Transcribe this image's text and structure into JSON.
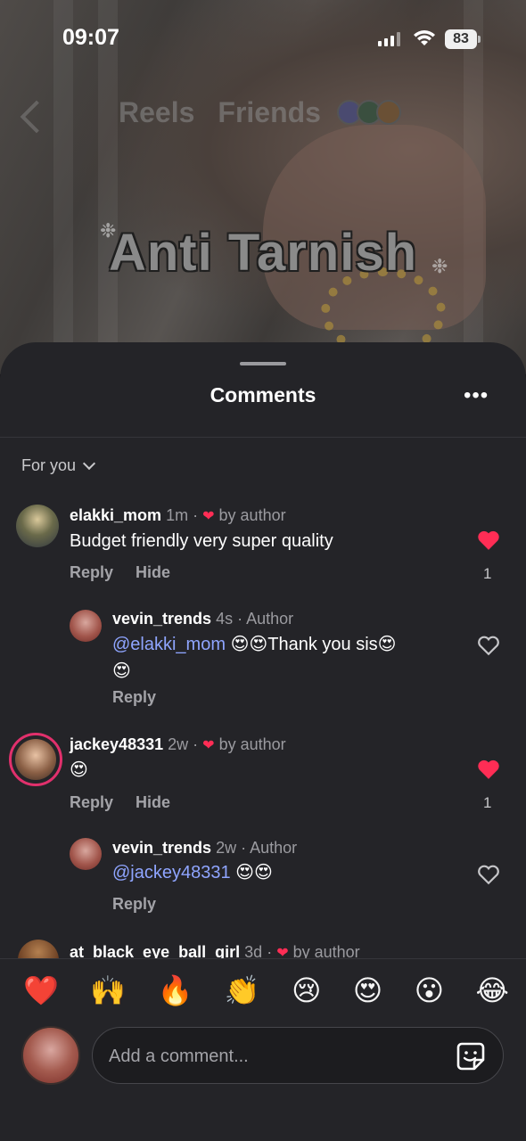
{
  "status": {
    "time": "09:07",
    "battery": "83"
  },
  "reel_tabs": [
    "Reels",
    "Friends"
  ],
  "overlay_text": "Anti Tarnish",
  "sheet": {
    "title": "Comments",
    "more_label": "•••"
  },
  "filter": {
    "label": "For you"
  },
  "comments": [
    {
      "user": "elakki_mom",
      "time": "1m",
      "meta": "by author",
      "text": "Budget friendly very super  quality",
      "actions": [
        "Reply",
        "Hide"
      ],
      "likes": "1",
      "liked": true
    },
    {
      "user": "vevin_trends",
      "time": "4s",
      "meta": "Author",
      "mention": "@elakki_mom",
      "text_after": " 😍😍Thank you sis😍",
      "text_line2": "😍",
      "actions": [
        "Reply"
      ],
      "liked": false
    },
    {
      "user": "jackey48331",
      "time": "2w",
      "meta": "by author",
      "text": "😍",
      "actions": [
        "Reply",
        "Hide"
      ],
      "likes": "1",
      "liked": true
    },
    {
      "user": "vevin_trends",
      "time": "2w",
      "meta": "Author",
      "mention": "@jackey48331",
      "text_after": " 😍😍",
      "actions": [
        "Reply"
      ],
      "liked": false
    },
    {
      "user": "at_black_eye_ball_girl",
      "time": "3d",
      "meta": "by author"
    }
  ],
  "quick_emojis": [
    "❤️",
    "🙌",
    "🔥",
    "👏",
    "😢",
    "😍",
    "😮",
    "😂"
  ],
  "comment_input": {
    "placeholder": "Add a comment..."
  },
  "colors": {
    "sheet_bg": "#242428",
    "like_red": "#ff2d55",
    "mention_blue": "#8fa5ff"
  }
}
